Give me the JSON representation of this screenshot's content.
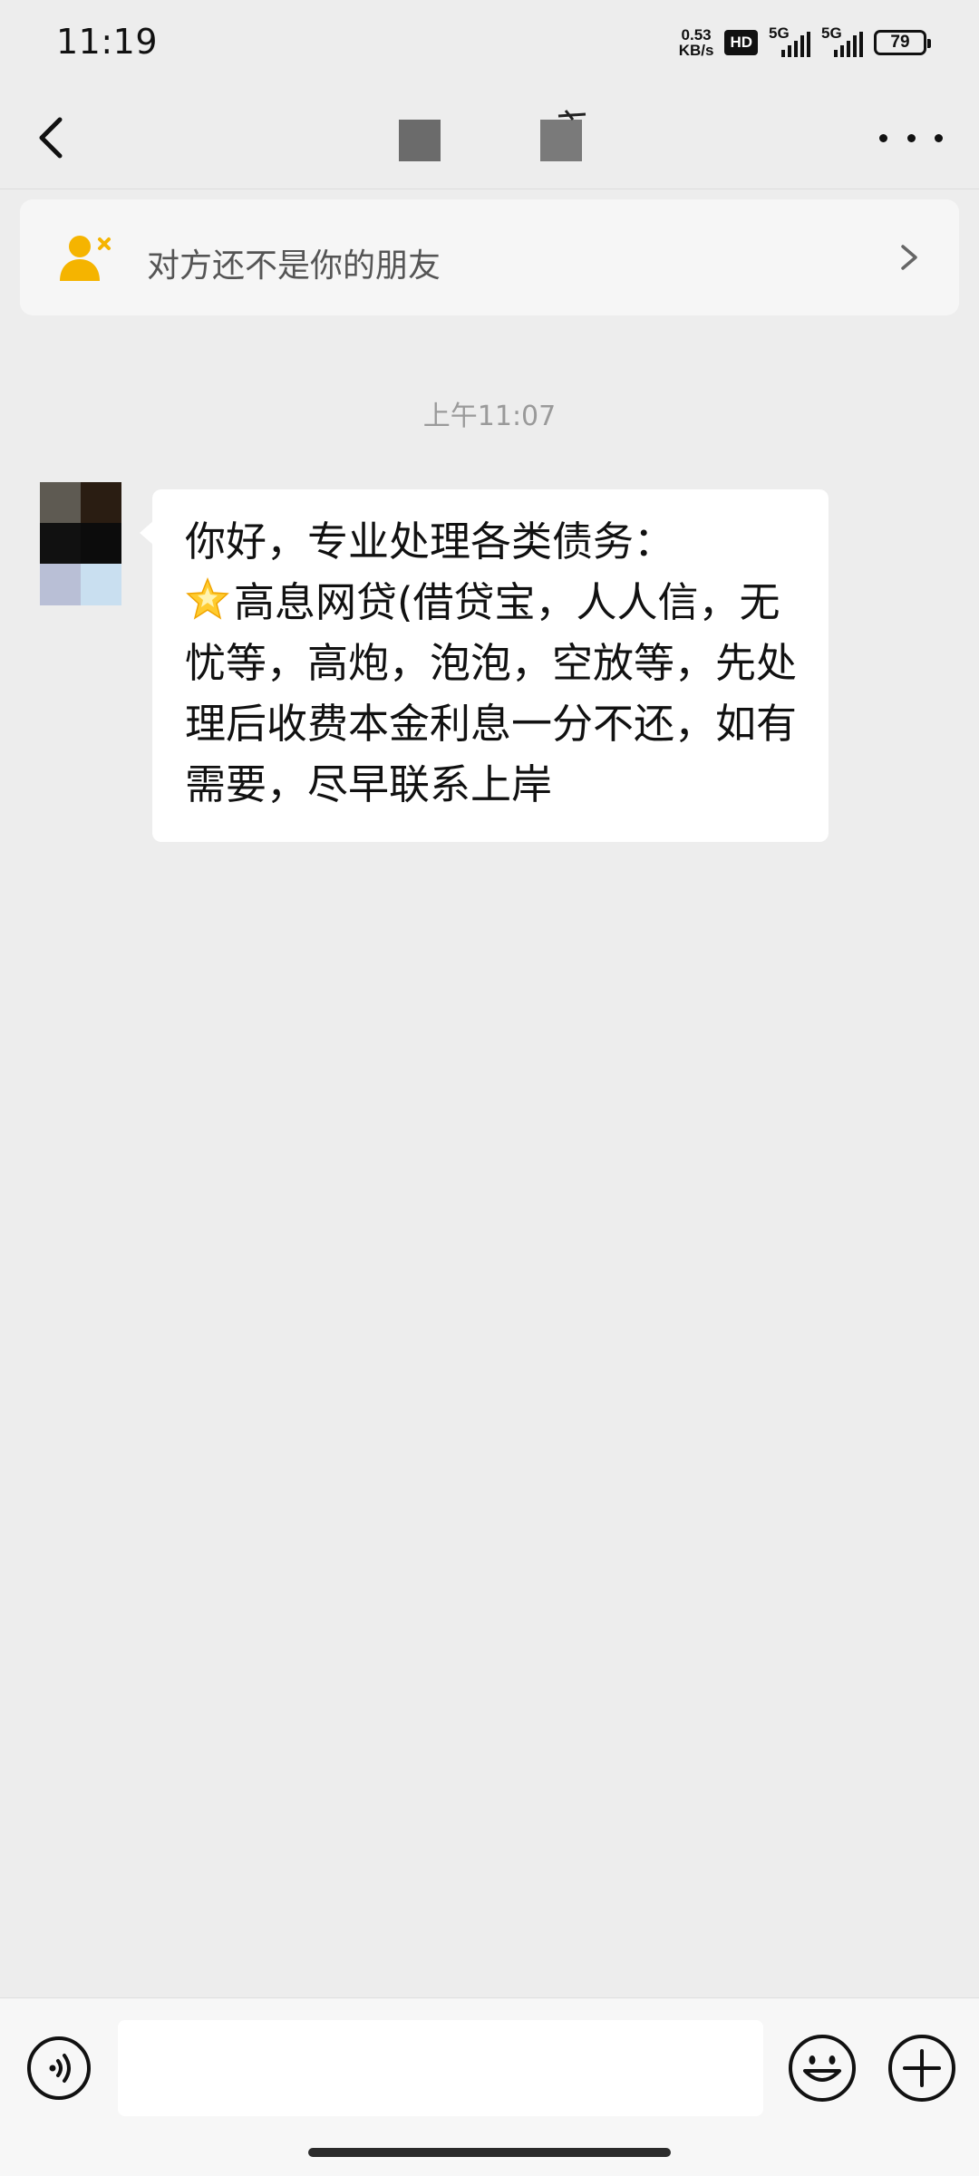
{
  "status_bar": {
    "time": "11:19",
    "net_speed_value": "0.53",
    "net_speed_unit": "KB/s",
    "hd_label": "HD",
    "signal1_label": "5G",
    "signal2_label": "5G",
    "battery_level": "79"
  },
  "nav": {
    "back_icon": "chevron-left-icon",
    "more_icon": "more-dots-icon"
  },
  "stranger_banner": {
    "text": "对方还不是你的朋友",
    "icon": "add-friend-person-icon",
    "accent_color": "#f5b400"
  },
  "chat": {
    "timestamp": "上午11:07",
    "message_lines": [
      "你好，专业处理各类债务：",
      "高息网贷(借贷宝，人人信，无",
      "忧等，高炮，泡泡，空放等，先处",
      "理后收费本金利息一分不还，如有",
      "需要，尽早联系上岸"
    ],
    "line2_prefix_icon": "glowing-star-icon"
  },
  "input_bar": {
    "voice_icon": "voice-input-icon",
    "text_value": "",
    "emoji_icon": "emoji-icon",
    "plus_icon": "plus-icon"
  }
}
